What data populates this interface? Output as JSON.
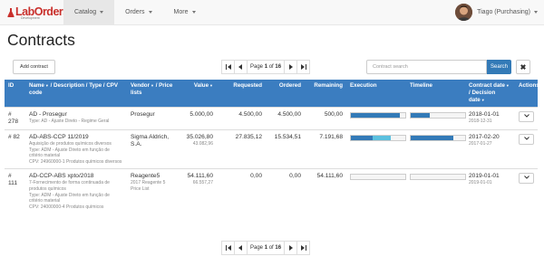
{
  "navbar": {
    "logo_text": "LabOrders",
    "logo_sub": "Development",
    "menu": [
      {
        "label": "Catalog",
        "active": true
      },
      {
        "label": "Orders",
        "active": false
      },
      {
        "label": "More",
        "active": false
      }
    ],
    "user_label": "Tiago (Purchasing)"
  },
  "page_title": "Contracts",
  "toolbar": {
    "add_label": "Add contract",
    "page_prefix": "Page",
    "page_current": "1",
    "page_of": "of",
    "page_total": "16",
    "search_placeholder": "Contract search",
    "search_label": "Search",
    "clear_label": "✖"
  },
  "table": {
    "headers": {
      "id": "ID",
      "name_bold": "Name",
      "name_rest": "/ Description / Type / CPV code",
      "vendor_bold": "Vendor",
      "vendor_rest": "/ Price lists",
      "value": "Value",
      "requested": "Requested",
      "ordered": "Ordered",
      "remaining": "Remaining",
      "execution": "Execution",
      "timeline": "Timeline",
      "contract_date_bold": "Contract date",
      "contract_date_rest": "/ Decision date",
      "actions": "Actions"
    },
    "rows": [
      {
        "id": "# 278",
        "name": "AD - Prosegur",
        "desc_lines": [
          "Type: AD - Ajuste Direto - Regime Geral"
        ],
        "vendor": "Prosegur",
        "vendor_sub": "",
        "value": "5.000,00",
        "value_sub": "",
        "requested": "4.500,00",
        "ordered": "4.500,00",
        "remaining": "500,00",
        "execution_ordered": 0.9,
        "execution_requested": 0.9,
        "timeline": 0.35,
        "contract_date": "2018-01-01",
        "decision_date": "2018-12-31"
      },
      {
        "id": "# 82",
        "name": "AD-ABS-CCP 11/2019",
        "desc_lines": [
          "Aquisição de produtos químicos diversos",
          "Type: ADM - Ajuste Direto em função de critério material",
          "CPV: 24960000-1 Produtos químicos diversos"
        ],
        "vendor": "Sigma Aldrich, S.A.",
        "vendor_sub": "",
        "value": "35.026,80",
        "value_sub": "43.082,96",
        "requested": "27.835,12",
        "ordered": "15.534,51",
        "remaining": "7.191,68",
        "execution_ordered": 0.4,
        "execution_requested": 0.74,
        "timeline": 0.78,
        "contract_date": "2017-02-20",
        "decision_date": "2017-01-27"
      },
      {
        "id": "# 111",
        "name": "AD-CCP-ABS xpto/2018",
        "desc_lines": [
          "7-Fornecimento de forma continuada de produtos químicos",
          "Type: ADM - Ajuste Direto em função de critério material",
          "CPV: 24000000-4 Produtos químicos"
        ],
        "vendor": "Reagente5",
        "vendor_sub": "2017 Reagente 5 Price List",
        "value": "54.111,60",
        "value_sub": "66.557,27",
        "requested": "0,00",
        "ordered": "0,00",
        "remaining": "54.111,60",
        "execution_ordered": 0.0,
        "execution_requested": 0.0,
        "timeline": 0.0,
        "contract_date": "2019-01-01",
        "decision_date": "2019-01-01"
      }
    ]
  },
  "colors": {
    "brand": "#c9302c",
    "header_bg": "#3b7dc0",
    "bar_fill": "#337ab7",
    "bar_fill_light": "#5bc0de"
  }
}
